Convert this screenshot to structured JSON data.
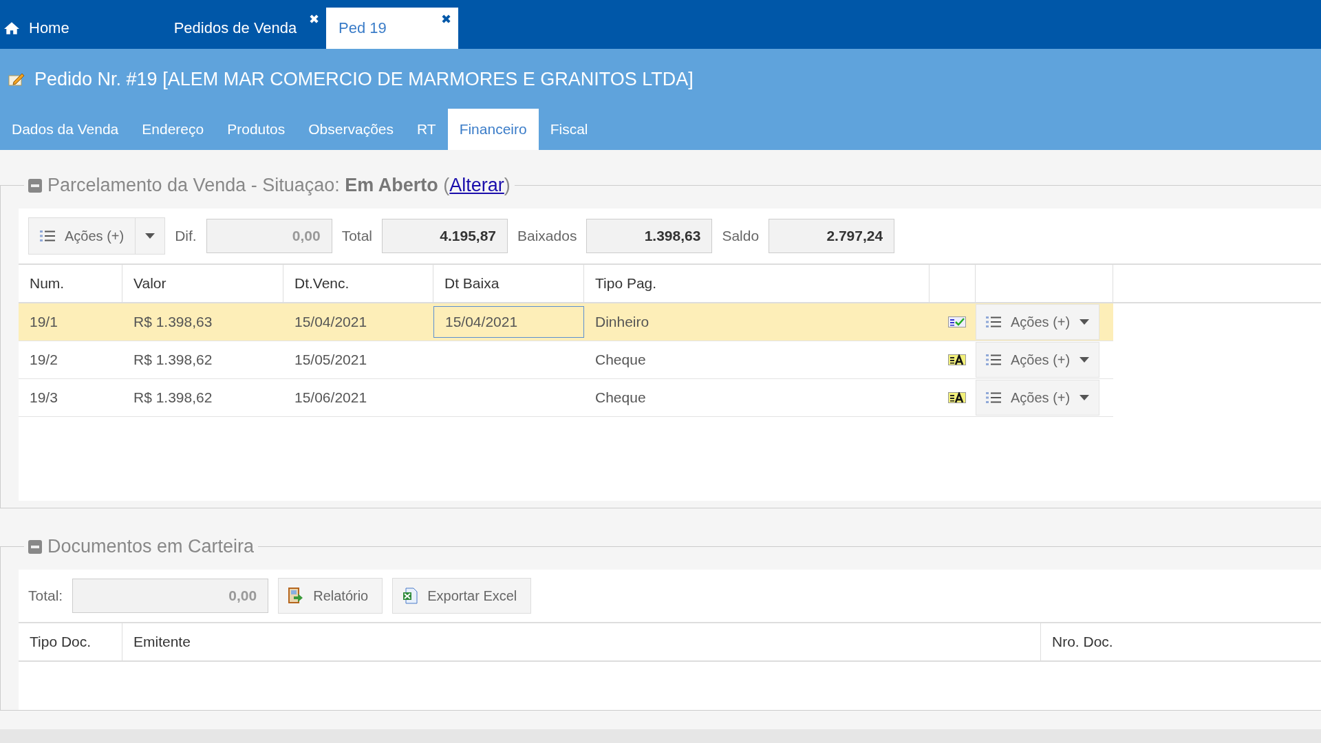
{
  "top_tabs": [
    {
      "label": "Home",
      "kind": "home",
      "selected": false
    },
    {
      "label": "Pedidos de Venda",
      "kind": "page",
      "selected": false,
      "close": "✖"
    },
    {
      "label": "Ped 19",
      "kind": "page",
      "selected": true,
      "close": "✖"
    }
  ],
  "title": "Pedido Nr. #19 [ALEM MAR COMERCIO DE MARMORES E GRANITOS LTDA]",
  "tabs": [
    {
      "label": "Dados da Venda",
      "selected": false
    },
    {
      "label": "Endereço",
      "selected": false
    },
    {
      "label": "Produtos",
      "selected": false
    },
    {
      "label": "Observações",
      "selected": false
    },
    {
      "label": "RT",
      "selected": false
    },
    {
      "label": "Financeiro",
      "selected": true
    },
    {
      "label": "Fiscal",
      "selected": false
    }
  ],
  "parcelamento": {
    "legend": "Parcelamento da Venda - Situaçao: **Em Aberto** (",
    "link": "Alterar",
    "legend_end": ")",
    "actions_button": "Ações (+)",
    "fields": [
      {
        "label": "Dif.",
        "value": "0,00",
        "bold": false
      },
      {
        "label": "Total",
        "value": "4.195,87",
        "bold": true
      },
      {
        "label": "Baixados",
        "value": "1.398,63",
        "bold": true
      },
      {
        "label": "Saldo",
        "value": "2.797,24",
        "bold": true
      }
    ],
    "columns": [
      "Num.",
      "Valor",
      "Dt.Venc.",
      "Dt Baixa",
      "Tipo Pag."
    ],
    "rows": [
      {
        "num": "19/1",
        "valor": "R$ 1.398,63",
        "dt_venc": "15/04/2021",
        "dt_baixa": "15/04/2021",
        "tipo_pag": "Dinheiro",
        "paid": true,
        "selected": true,
        "actions": "Ações (+)"
      },
      {
        "num": "19/2",
        "valor": "R$ 1.398,62",
        "dt_venc": "15/05/2021",
        "tipo_pag": "Cheque",
        "paid": false,
        "selected": false,
        "actions": "Ações (+)"
      },
      {
        "num": "19/3",
        "valor": "R$ 1.398,62",
        "dt_venc": "15/06/2021",
        "tipo_pag": "Cheque",
        "paid": false,
        "selected": false,
        "actions": "Ações (+)"
      }
    ]
  },
  "documentos": {
    "legend": "Documentos em Carteira",
    "total_label": "Total:",
    "total_value": "0,00",
    "buttons": [
      {
        "label": "Relatório",
        "kind": "report"
      },
      {
        "label": "Exportar Excel",
        "kind": "excel"
      }
    ],
    "columns": [
      "Tipo Doc.",
      "Emitente",
      "Nro. Doc."
    ]
  }
}
